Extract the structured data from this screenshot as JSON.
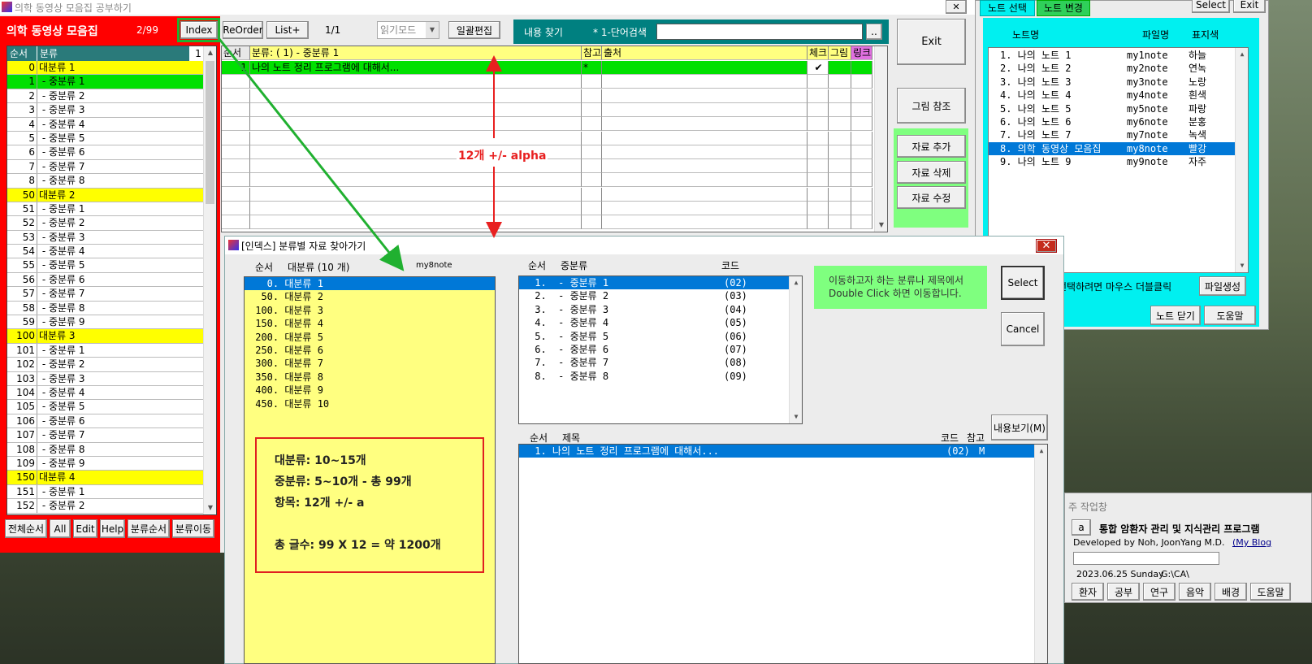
{
  "main_window": {
    "title": "의학 동영상 모음집 공부하기",
    "app_name": "의학 동영상 모음집",
    "page_count": "2/99",
    "toolbar": {
      "index_label": "Index",
      "reorder_label": "ReOrder",
      "list_plus_label": "List+",
      "page_indicator": "1/1",
      "mode_select": "읽기모드",
      "bulk_edit_label": "일괄편집",
      "search_label": "내용 찾기",
      "search_mode": "* 1-단어검색",
      "search_go": ".."
    },
    "category_list": {
      "col_order": "순서",
      "col_category": "분류",
      "counter": "1",
      "rows": [
        {
          "num": "0",
          "label": "대분류 1",
          "kind": "major"
        },
        {
          "num": "1",
          "label": " - 중분류 1",
          "kind": "selected"
        },
        {
          "num": "2",
          "label": " - 중분류 2",
          "kind": "minor"
        },
        {
          "num": "3",
          "label": " - 중분류 3",
          "kind": "minor"
        },
        {
          "num": "4",
          "label": " - 중분류 4",
          "kind": "minor"
        },
        {
          "num": "5",
          "label": " - 중분류 5",
          "kind": "minor"
        },
        {
          "num": "6",
          "label": " - 중분류 6",
          "kind": "minor"
        },
        {
          "num": "7",
          "label": " - 중분류 7",
          "kind": "minor"
        },
        {
          "num": "8",
          "label": " - 중분류 8",
          "kind": "minor"
        },
        {
          "num": "50",
          "label": "대분류 2",
          "kind": "major"
        },
        {
          "num": "51",
          "label": " - 중분류 1",
          "kind": "minor"
        },
        {
          "num": "52",
          "label": " - 중분류 2",
          "kind": "minor"
        },
        {
          "num": "53",
          "label": " - 중분류 3",
          "kind": "minor"
        },
        {
          "num": "54",
          "label": " - 중분류 4",
          "kind": "minor"
        },
        {
          "num": "55",
          "label": " - 중분류 5",
          "kind": "minor"
        },
        {
          "num": "56",
          "label": " - 중분류 6",
          "kind": "minor"
        },
        {
          "num": "57",
          "label": " - 중분류 7",
          "kind": "minor"
        },
        {
          "num": "58",
          "label": " - 중분류 8",
          "kind": "minor"
        },
        {
          "num": "59",
          "label": " - 중분류 9",
          "kind": "minor"
        },
        {
          "num": "100",
          "label": "대분류 3",
          "kind": "major"
        },
        {
          "num": "101",
          "label": " - 중분류 1",
          "kind": "minor"
        },
        {
          "num": "102",
          "label": " - 중분류 2",
          "kind": "minor"
        },
        {
          "num": "103",
          "label": " - 중분류 3",
          "kind": "minor"
        },
        {
          "num": "104",
          "label": " - 중분류 4",
          "kind": "minor"
        },
        {
          "num": "105",
          "label": " - 중분류 5",
          "kind": "minor"
        },
        {
          "num": "106",
          "label": " - 중분류 6",
          "kind": "minor"
        },
        {
          "num": "107",
          "label": " - 중분류 7",
          "kind": "minor"
        },
        {
          "num": "108",
          "label": " - 중분류 8",
          "kind": "minor"
        },
        {
          "num": "109",
          "label": " - 중분류 9",
          "kind": "minor"
        },
        {
          "num": "150",
          "label": "대분류 4",
          "kind": "major"
        },
        {
          "num": "151",
          "label": " - 중분류 1",
          "kind": "minor"
        },
        {
          "num": "152",
          "label": " - 중분류 2",
          "kind": "minor"
        }
      ]
    },
    "bottom_buttons": [
      "전체순서",
      "All",
      "Edit",
      "Help",
      "분류순서",
      "분류이동"
    ],
    "item_grid": {
      "headers": [
        "순서",
        "분류: (  1)  - 중분류 1",
        "참고",
        "출처",
        "체크",
        "그림",
        "링크"
      ],
      "rows": [
        {
          "num": "1",
          "title": "나의 노트 정리 프로그램에 대해서...",
          "ref": "*",
          "source": "",
          "check": "✔",
          "pic": "",
          "link": ""
        }
      ],
      "annotation": "12개 +/- alpha"
    },
    "right_buttons": {
      "exit": "Exit",
      "picture_ref": "그림 참조",
      "add": "자료 추가",
      "delete": "자료 삭제",
      "edit": "자료 수정"
    }
  },
  "note_window": {
    "tabs": [
      "노트 선택",
      "노트 변경"
    ],
    "top_buttons": [
      "Select",
      "Exit"
    ],
    "col_name": "노트명",
    "col_file": "파일명",
    "col_color": "표지색",
    "notes": [
      {
        "name": "1. 나의 노트 1",
        "file": "my1note",
        "color": "하늘"
      },
      {
        "name": "2. 나의 노트 2",
        "file": "my2note",
        "color": "연녹"
      },
      {
        "name": "3. 나의 노트 3",
        "file": "my3note",
        "color": "노랑"
      },
      {
        "name": "4. 나의 노트 4",
        "file": "my4note",
        "color": "흰색"
      },
      {
        "name": "5. 나의 노트 5",
        "file": "my5note",
        "color": "파랑"
      },
      {
        "name": "6. 나의 노트 6",
        "file": "my6note",
        "color": "분홍"
      },
      {
        "name": "7. 나의 노트 7",
        "file": "my7note",
        "color": "녹색"
      },
      {
        "name": "8. 의학 동영상 모음집",
        "file": "my8note",
        "color": "빨강",
        "selected": true
      },
      {
        "name": "9. 나의 노트 9",
        "file": "my9note",
        "color": "자주"
      }
    ],
    "hint": "선택하려면 마우스 더블클릭",
    "create_file": "파일생성",
    "close_note": "노트 닫기",
    "help": "도움말"
  },
  "work_window": {
    "title": "주 작업창",
    "a_button": "a",
    "program_title": "통합 암환자 관리 및 지식관리 프로그램",
    "developer": "Developed by Noh, JoonYang  M.D.",
    "blog_link": "(My Blog",
    "date": "2023.06.25 Sunday",
    "path": "G:\\CA\\",
    "buttons": [
      "환자",
      "공부",
      "연구",
      "음악",
      "배경",
      "도움말"
    ]
  },
  "index_dialog": {
    "title": "[인덱스] 분류별 자료 찾아가기",
    "major_header_order": "순서",
    "major_header_label": "대분류 (10 개)",
    "file_name": "my8note",
    "major_list": [
      "   0. 대분류 1",
      "  50. 대분류 2",
      " 100. 대분류 3",
      " 150. 대분류 4",
      " 200. 대분류 5",
      " 250. 대분류 6",
      " 300. 대분류 7",
      " 350. 대분류 8",
      " 400. 대분류 9",
      " 450. 대분류 10"
    ],
    "mid_header_order": "순서",
    "mid_header_label": "중분류",
    "mid_header_code": "코드",
    "mid_list": [
      {
        "label": " 1.  - 중분류 1",
        "code": "(02)"
      },
      {
        "label": " 2.  - 중분류 2",
        "code": "(03)"
      },
      {
        "label": " 3.  - 중분류 3",
        "code": "(04)"
      },
      {
        "label": " 4.  - 중분류 4",
        "code": "(05)"
      },
      {
        "label": " 5.  - 중분류 5",
        "code": "(06)"
      },
      {
        "label": " 6.  - 중분류 6",
        "code": "(07)"
      },
      {
        "label": " 7.  - 중분류 7",
        "code": "(08)"
      },
      {
        "label": " 8.  - 중분류 8",
        "code": "(09)"
      }
    ],
    "info_text_1": "이동하고자 하는 분류나 제목에서",
    "info_text_2": "Double Click 하면 이동합니다.",
    "select_label": "Select",
    "cancel_label": "Cancel",
    "view_content_label": "내용보기(M)",
    "title_header_order": "순서",
    "title_header_title": "제목",
    "title_header_code": "코드",
    "title_header_ref": "참고",
    "title_list": [
      {
        "label": " 1. 나의 노트 정리 프로그램에 대해서...",
        "code": "(02)",
        "ref": "M"
      }
    ],
    "annotation_lines": [
      "대분류: 10~15개",
      "중분류:  5~10개 - 총 99개",
      "항목: 12개 +/- a",
      "",
      "총 글수: 99 X 12 = 약 1200개"
    ]
  },
  "colors": {
    "red_panel": "#ff0000",
    "major_highlight": "#ffff00",
    "selected_green": "#00e000",
    "teal_search": "#008080",
    "cyan_note": "#00f0f0",
    "accent_blue": "#0078d7",
    "annotation_red": "#e82020",
    "annotation_green": "#20b030"
  }
}
